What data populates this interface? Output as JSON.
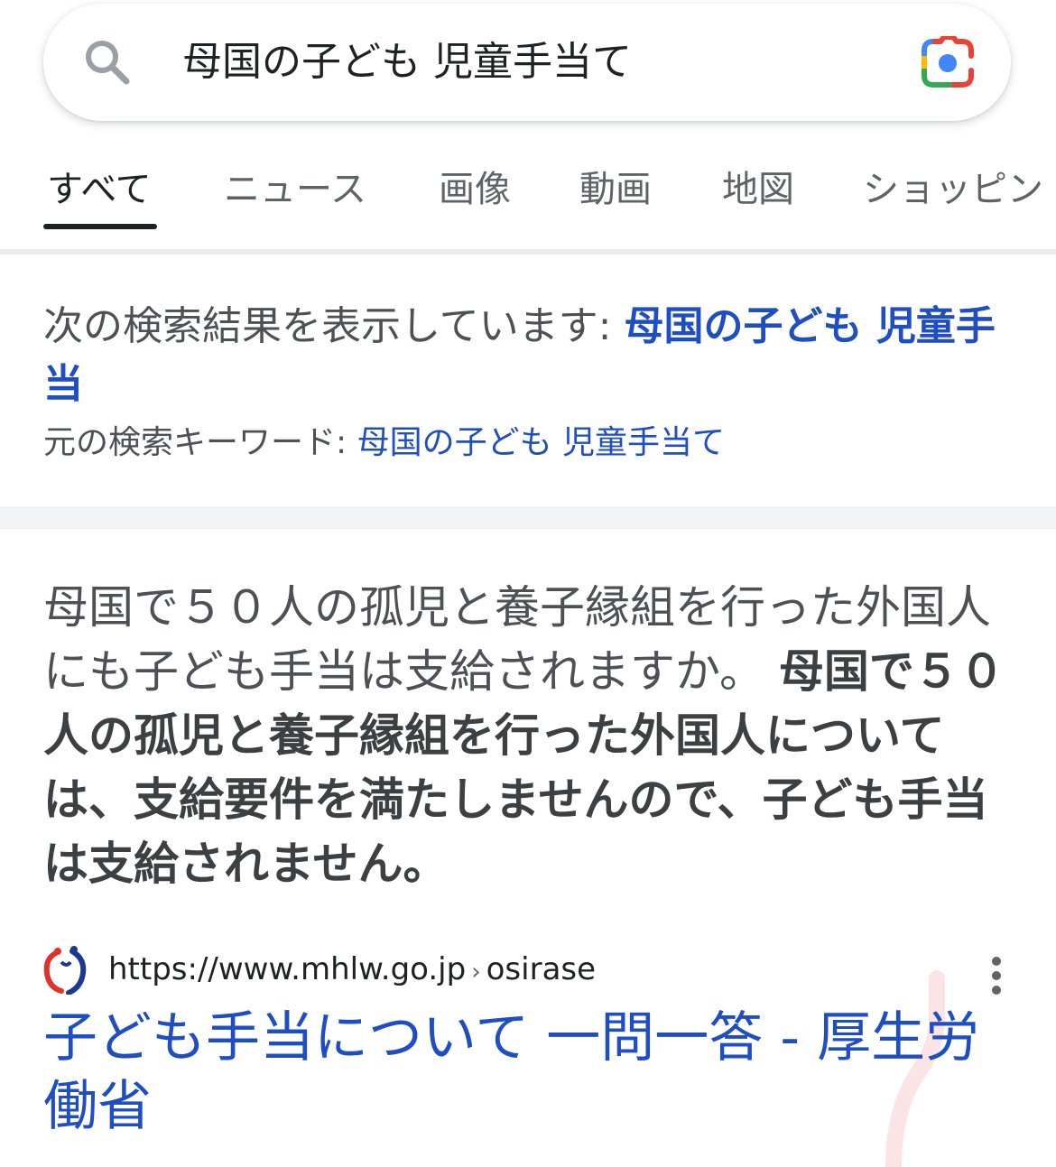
{
  "search": {
    "query": "母国の子ども 児童手当て"
  },
  "tabs": [
    {
      "label": "すべて",
      "active": true
    },
    {
      "label": "ニュース"
    },
    {
      "label": "画像"
    },
    {
      "label": "動画"
    },
    {
      "label": "地図"
    },
    {
      "label": "ショッピン"
    }
  ],
  "correction": {
    "prefix": "次の検索結果を表示しています: ",
    "corrected_query": "母国の子ども 児童手当",
    "original_prefix": "元の検索キーワード: ",
    "original_query": "母国の子ども 児童手当て"
  },
  "snippet": {
    "question": "母国で５０人の孤児と養子縁組を行った外国人にも子ども手当は支給されますか。",
    "answer": "母国で５０人の孤児と養子縁組を行った外国人については、支給要件を満たしませんので、子ども手当は支給されません。"
  },
  "result": {
    "url_domain": "https://www.mhlw.go.jp",
    "url_separator": "›",
    "url_path": "osirase",
    "title": "子ども手当について 一問一答 - 厚生労働省"
  },
  "icons": {
    "search": "search-icon",
    "lens": "google-lens-icon",
    "favicon": "mhlw-favicon",
    "more": "more-vert-icon"
  },
  "colors": {
    "link": "#1f4ec2",
    "text": "#202124",
    "secondary_text": "#4d5156"
  }
}
